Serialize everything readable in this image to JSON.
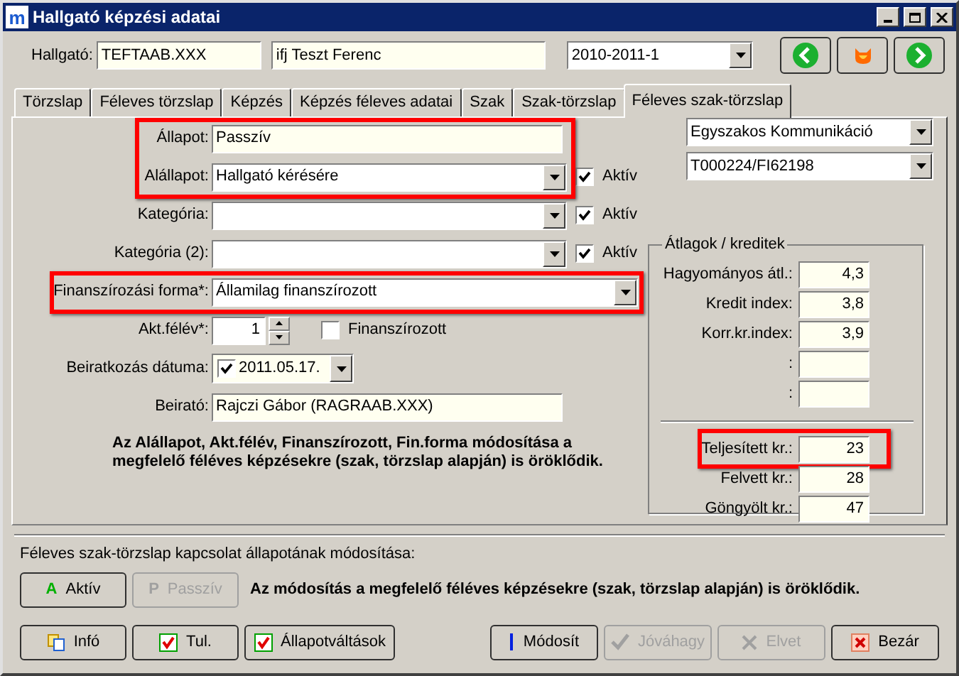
{
  "window": {
    "title": "Hallgató képzési adatai",
    "logo_text": "m"
  },
  "header": {
    "label": "Hallgató:",
    "code": "TEFTAAB.XXX",
    "name": "ifj Teszt Ferenc",
    "semester": "2010-2011-1"
  },
  "tabs": [
    {
      "label": "Törzslap",
      "selected": false
    },
    {
      "label": "Féleves törzslap",
      "selected": false
    },
    {
      "label": "Képzés",
      "selected": false
    },
    {
      "label": "Képzés féleves adatai",
      "selected": false
    },
    {
      "label": "Szak",
      "selected": false
    },
    {
      "label": "Szak-törzslap",
      "selected": false
    },
    {
      "label": "Féleves szak-törzslap",
      "selected": true
    }
  ],
  "form": {
    "sections": [
      {
        "highlighted": true,
        "rows": [
          {
            "kind": "text",
            "label": "Állapot:",
            "value": "Passzív"
          },
          {
            "kind": "combo",
            "label": "Alállapot:",
            "value": "Hallgató kérésére",
            "checkbox": {
              "label": "Aktív",
              "checked": true
            }
          }
        ]
      },
      {
        "highlighted": false,
        "rows": [
          {
            "kind": "combo",
            "label": "Kategória:",
            "value": "",
            "checkbox": {
              "label": "Aktív",
              "checked": true
            }
          },
          {
            "kind": "combo",
            "label": "Kategória (2):",
            "value": "",
            "checkbox": {
              "label": "Aktív",
              "checked": true
            }
          }
        ]
      },
      {
        "highlighted": true,
        "rows": [
          {
            "kind": "combo",
            "label": "Finanszírozási forma*:",
            "value": "Államilag  finanszírozott"
          }
        ]
      },
      {
        "highlighted": false,
        "rows": [
          {
            "kind": "spin",
            "label": "Akt.félév*:",
            "value": "1",
            "checkbox": {
              "label": "Finanszírozott",
              "checked": false
            }
          },
          {
            "kind": "date",
            "label": "Beiratkozás dátuma:",
            "value": "2011.05.17.",
            "checked": true
          },
          {
            "kind": "text",
            "label": "Beirató:",
            "value": "Rajczi Gábor (RAGRAAB.XXX)"
          }
        ]
      }
    ],
    "note": "Az Alállapot, Akt.félév, Finanszírozott, Fin.forma módosítása a megfelelő féléves képzésekre (szak, törzslap alapján) is öröklődik."
  },
  "right": {
    "combos": [
      "Egyszakos Kommunikáció",
      "T000224/FI62198"
    ],
    "group": {
      "title": "Átlagok / kreditek",
      "averages": [
        {
          "label": "Hagyományos átl.:",
          "value": "4,3",
          "highlighted": false
        },
        {
          "label": "Kredit index:",
          "value": "3,8",
          "highlighted": false
        },
        {
          "label": "Korr.kr.index:",
          "value": "3,9",
          "highlighted": false
        },
        {
          "label": ":",
          "highlighted": false
        },
        {
          "label": ":",
          "highlighted": false
        }
      ],
      "credits": [
        {
          "label": "Teljesített kr.:",
          "value": "23",
          "highlighted": true
        },
        {
          "label": "Felvett kr.:",
          "value": "28",
          "highlighted": false
        },
        {
          "label": "Göngyölt kr.:",
          "value": "47",
          "highlighted": false
        }
      ]
    }
  },
  "status_section": {
    "label": "Féleves szak-törzslap kapcsolat állapotának módosítása:",
    "buttons": [
      {
        "letter": "A",
        "label": "Aktív",
        "disabled": false
      },
      {
        "letter": "P",
        "label": "Passzív",
        "disabled": true
      }
    ],
    "note": "Az módosítás a megfelelő féléves képzésekre (szak, törzslap alapján) is öröklődik."
  },
  "footer": {
    "left": [
      {
        "label": "Infó",
        "disabled": false
      },
      {
        "label": "Tul.",
        "disabled": false
      },
      {
        "label": "Állapotváltások",
        "disabled": false
      }
    ],
    "right": [
      {
        "label": "Módosít",
        "disabled": false
      },
      {
        "label": "Jóváhagy",
        "disabled": true
      },
      {
        "label": "Elvet",
        "disabled": true
      },
      {
        "label": "Bezár",
        "disabled": false
      }
    ]
  }
}
